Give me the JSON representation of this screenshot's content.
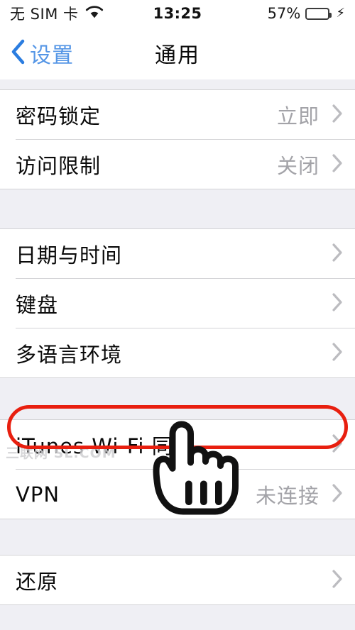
{
  "statusbar": {
    "carrier": "无 SIM 卡",
    "wifi_icon": "wifi-icon",
    "clock": "13:25",
    "battery_percent": "57%",
    "battery_level": 57,
    "charging_icon": "⚡",
    "battery_color": "#4cd552"
  },
  "navbar": {
    "back_icon": "chevron-left-icon",
    "back_label": "设置",
    "title": "通用",
    "accent_color": "#5596e6"
  },
  "groups": [
    {
      "id": "security-group",
      "rows": [
        {
          "id": "passcode-lock",
          "label": "密码锁定",
          "value": "立即",
          "chevron": "chevron-right-icon"
        },
        {
          "id": "restrictions",
          "label": "访问限制",
          "value": "关闭",
          "chevron": "chevron-right-icon"
        }
      ]
    },
    {
      "id": "datetime-group",
      "rows": [
        {
          "id": "date-and-time",
          "label": "日期与时间",
          "value": "",
          "chevron": "chevron-right-icon"
        },
        {
          "id": "keyboard",
          "label": "键盘",
          "value": "",
          "chevron": "chevron-right-icon"
        },
        {
          "id": "international",
          "label": "多语言环境",
          "value": "",
          "chevron": "chevron-right-icon"
        }
      ]
    },
    {
      "id": "sync-group",
      "rows": [
        {
          "id": "itunes-wifi-sync",
          "label": "iTunes Wi-Fi 同步",
          "value": "",
          "chevron": "chevron-right-icon"
        },
        {
          "id": "vpn",
          "label": "VPN",
          "value": "未连接",
          "chevron": "chevron-right-icon"
        }
      ]
    },
    {
      "id": "reset-group",
      "rows": [
        {
          "id": "reset",
          "label": "还原",
          "value": "",
          "chevron": "chevron-right-icon"
        }
      ]
    }
  ],
  "annotation": {
    "highlight_target": "iTunes Wi-Fi 同步",
    "highlight_color": "#e81f0f",
    "cursor_icon": "pointing-hand-cursor"
  },
  "watermark": {
    "text": "三联网 SL.COM"
  }
}
